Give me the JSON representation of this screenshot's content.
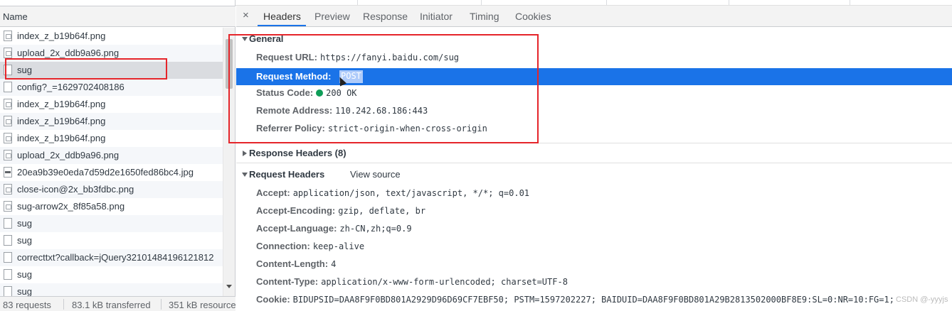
{
  "left_pane": {
    "column_header": "Name",
    "requests": [
      {
        "name": "index_z_b19b64f.png",
        "icon": "image-file-icon"
      },
      {
        "name": "upload_2x_ddb9a96.png",
        "icon": "image-file-icon"
      },
      {
        "name": "sug",
        "icon": "document-file-icon",
        "selected": true
      },
      {
        "name": "config?_=1629702408186",
        "icon": "document-file-icon"
      },
      {
        "name": "index_z_b19b64f.png",
        "icon": "image-file-icon"
      },
      {
        "name": "index_z_b19b64f.png",
        "icon": "image-file-icon"
      },
      {
        "name": "index_z_b19b64f.png",
        "icon": "image-file-icon"
      },
      {
        "name": "upload_2x_ddb9a96.png",
        "icon": "image-file-icon"
      },
      {
        "name": "20ea9b39e0eda7d59d2e1650fed86bc4.jpg",
        "icon": "jpg-file-icon"
      },
      {
        "name": "close-icon@2x_bb3fdbc.png",
        "icon": "image-file-icon"
      },
      {
        "name": "sug-arrow2x_8f85a58.png",
        "icon": "image-file-icon"
      },
      {
        "name": "sug",
        "icon": "document-file-icon"
      },
      {
        "name": "sug",
        "icon": "document-file-icon"
      },
      {
        "name": "correcttxt?callback=jQuery32101484196121812",
        "icon": "document-file-icon"
      },
      {
        "name": "sug",
        "icon": "document-file-icon"
      },
      {
        "name": "sug",
        "icon": "document-file-icon"
      }
    ],
    "status": {
      "requests": "83 requests",
      "transferred": "83.1 kB transferred",
      "resources": "351 kB resources"
    }
  },
  "right_pane": {
    "close_glyph": "×",
    "tabs": [
      "Headers",
      "Preview",
      "Response",
      "Initiator",
      "Timing",
      "Cookies"
    ],
    "active_tab": "Headers",
    "general": {
      "title": "General",
      "request_url_key": "Request URL:",
      "request_url": "https://fanyi.baidu.com/sug",
      "request_method_key": "Request Method:",
      "request_method": "POST",
      "status_code_key": "Status Code:",
      "status_code": "200 OK",
      "remote_address_key": "Remote Address:",
      "remote_address": "110.242.68.186:443",
      "referrer_policy_key": "Referrer Policy:",
      "referrer_policy": "strict-origin-when-cross-origin"
    },
    "response_headers": {
      "title": "Response Headers (8)"
    },
    "request_headers": {
      "title": "Request Headers",
      "view_source": "View source",
      "rows": [
        {
          "k": "Accept:",
          "v": "application/json, text/javascript, */*; q=0.01"
        },
        {
          "k": "Accept-Encoding:",
          "v": "gzip, deflate, br"
        },
        {
          "k": "Accept-Language:",
          "v": "zh-CN,zh;q=0.9"
        },
        {
          "k": "Connection:",
          "v": "keep-alive"
        },
        {
          "k": "Content-Length:",
          "v": "4"
        },
        {
          "k": "Content-Type:",
          "v": "application/x-www-form-urlencoded; charset=UTF-8"
        },
        {
          "k": "Cookie:",
          "v": "BIDUPSID=DAA8F9F0BD801A2929D96D69CF7EBF50; PSTM=1597202227; BAIDUID=DAA8F9F0BD801A29B2813502000BF8E9:SL=0:NR=10:FG=1;"
        }
      ]
    },
    "watermark": "CSDN @-yyyjs"
  },
  "colors": {
    "selection_blue": "#1a73e8",
    "annotation_red": "#e5252a",
    "status_green": "#0f9d58"
  }
}
